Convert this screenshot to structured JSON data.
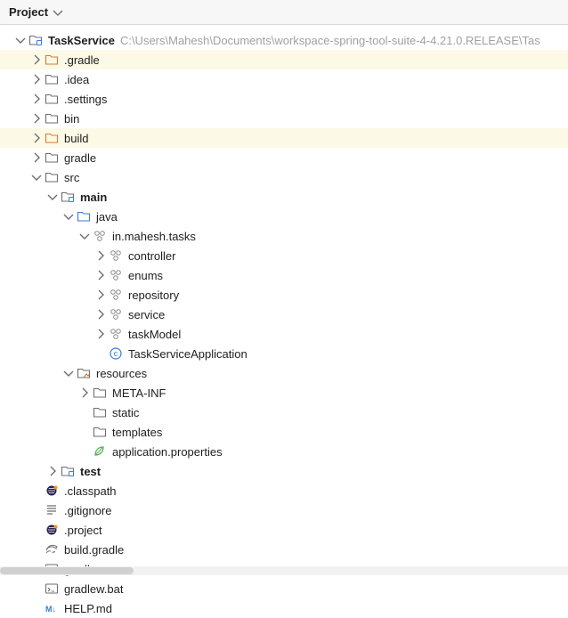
{
  "header": {
    "title": "Project"
  },
  "tree": {
    "root": {
      "name": "TaskService",
      "path": "C:\\Users\\Mahesh\\Documents\\workspace-spring-tool-suite-4-4.21.0.RELEASE\\Tas"
    },
    "items": [
      {
        "label": ".gradle"
      },
      {
        "label": ".idea"
      },
      {
        "label": ".settings"
      },
      {
        "label": "bin"
      },
      {
        "label": "build"
      },
      {
        "label": "gradle"
      },
      {
        "label": "src"
      },
      {
        "label": "main"
      },
      {
        "label": "java"
      },
      {
        "label": "in.mahesh.tasks"
      },
      {
        "label": "controller"
      },
      {
        "label": "enums"
      },
      {
        "label": "repository"
      },
      {
        "label": "service"
      },
      {
        "label": "taskModel"
      },
      {
        "label": "TaskServiceApplication"
      },
      {
        "label": "resources"
      },
      {
        "label": "META-INF"
      },
      {
        "label": "static"
      },
      {
        "label": "templates"
      },
      {
        "label": "application.properties"
      },
      {
        "label": "test"
      },
      {
        "label": ".classpath"
      },
      {
        "label": ".gitignore"
      },
      {
        "label": ".project"
      },
      {
        "label": "build.gradle"
      },
      {
        "label": "gradlew"
      },
      {
        "label": "gradlew.bat"
      },
      {
        "label": "HELP.md"
      }
    ]
  }
}
